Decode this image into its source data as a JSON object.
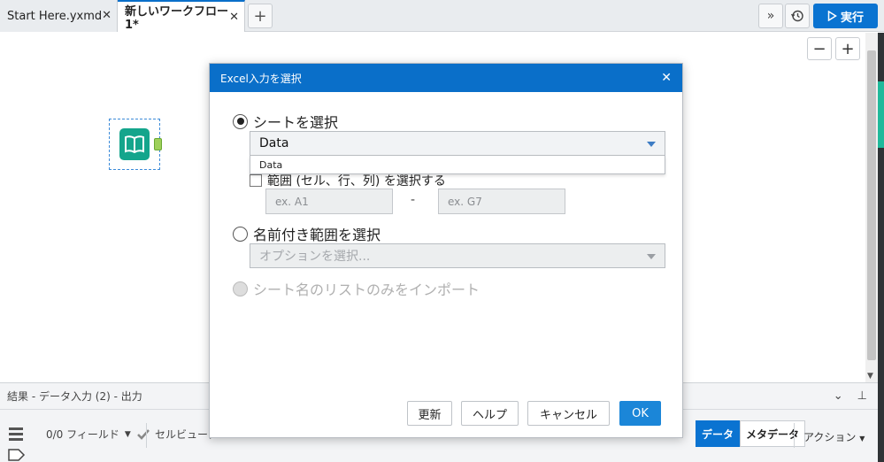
{
  "tabs": [
    {
      "label": "Start Here.yxmd",
      "close": "✕"
    },
    {
      "label": "新しいワークフロー1*",
      "close": "✕"
    }
  ],
  "toolbar": {
    "add_tab": "+",
    "expand": "»",
    "run_label": "実行"
  },
  "canvas": {
    "zoom_out": "−",
    "zoom_in": "+"
  },
  "results": {
    "title": "結果 - データ入力 (2) - 出力",
    "fields": "0/0 フィールド",
    "cell_viewer": "セルビューア",
    "tab_data": "データ",
    "tab_metadata": "メタデータ",
    "actions": "アクション"
  },
  "dialog": {
    "title": "Excel入力を選択",
    "close": "✕",
    "opt_sheet": "シートを選択",
    "sheet_selected": "Data",
    "sheet_options": [
      "Data"
    ],
    "opt_range": "範囲 (セル、行、列) を選択する",
    "range_from_placeholder": "ex. A1",
    "range_to_placeholder": "ex. G7",
    "range_dash": "-",
    "opt_named": "名前付き範囲を選択",
    "named_placeholder": "オプションを選択...",
    "opt_list_only": "シート名のリストのみをインポート",
    "btn_refresh": "更新",
    "btn_help": "ヘルプ",
    "btn_cancel": "キャンセル",
    "btn_ok": "OK"
  },
  "colors": {
    "accent": "#0a6fc9",
    "tool": "#14a58c",
    "ok": "#1b86d8"
  }
}
